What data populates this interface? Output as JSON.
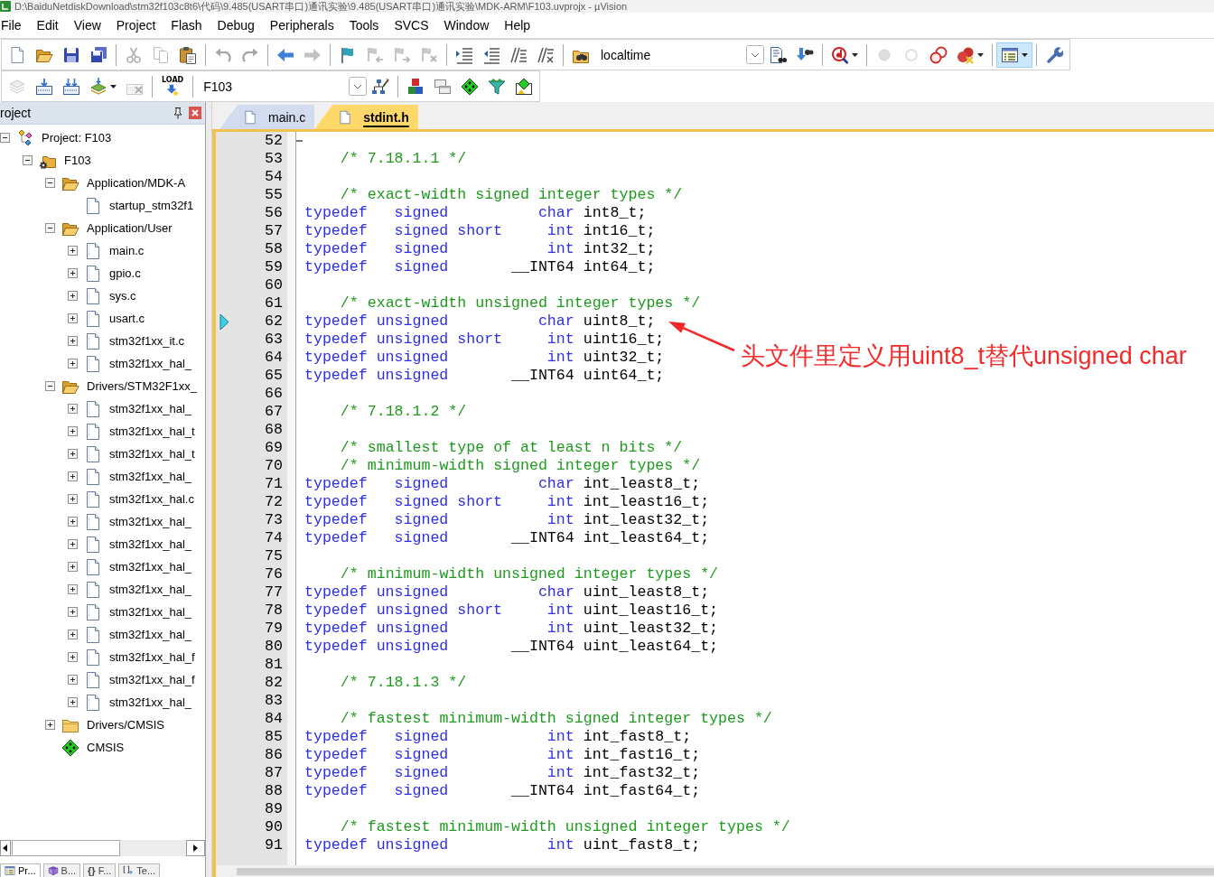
{
  "window": {
    "title": "D:\\BaiduNetdiskDownload\\stm32f103c8t6\\代码\\9.485(USART串口)通讯实验\\9.485(USART串口)通讯实验\\MDK-ARM\\F103.uvprojx - µVision"
  },
  "menu": [
    "File",
    "Edit",
    "View",
    "Project",
    "Flash",
    "Debug",
    "Peripherals",
    "Tools",
    "SVCS",
    "Window",
    "Help"
  ],
  "toolbar_1": {
    "items": [
      {
        "kind": "button",
        "disabled": false,
        "pressed": false,
        "menu": false
      },
      {
        "kind": "button",
        "disabled": false,
        "pressed": false,
        "menu": false
      },
      {
        "kind": "button",
        "disabled": false,
        "pressed": false,
        "menu": false
      },
      {
        "kind": "button",
        "disabled": false,
        "pressed": false,
        "menu": false
      },
      {
        "kind": "separator"
      },
      {
        "kind": "button",
        "disabled": true,
        "pressed": false,
        "menu": false
      },
      {
        "kind": "button",
        "disabled": true,
        "pressed": false,
        "menu": false
      },
      {
        "kind": "button",
        "disabled": false,
        "pressed": false,
        "menu": false
      },
      {
        "kind": "separator"
      },
      {
        "kind": "button",
        "disabled": true,
        "pressed": false,
        "menu": false
      },
      {
        "kind": "button",
        "disabled": true,
        "pressed": false,
        "menu": false
      },
      {
        "kind": "separator"
      },
      {
        "kind": "button",
        "disabled": false,
        "pressed": false,
        "menu": false
      },
      {
        "kind": "button",
        "disabled": true,
        "pressed": false,
        "menu": false
      },
      {
        "kind": "separator"
      },
      {
        "kind": "button",
        "disabled": false,
        "pressed": false,
        "menu": false
      },
      {
        "kind": "button",
        "disabled": true,
        "pressed": false,
        "menu": false
      },
      {
        "kind": "button",
        "disabled": true,
        "pressed": false,
        "menu": false
      },
      {
        "kind": "button",
        "disabled": true,
        "pressed": false,
        "menu": false
      },
      {
        "kind": "separator"
      },
      {
        "kind": "button",
        "disabled": false,
        "pressed": false,
        "menu": false
      },
      {
        "kind": "button",
        "disabled": false,
        "pressed": false,
        "menu": false
      },
      {
        "kind": "button",
        "disabled": false,
        "pressed": false,
        "menu": false
      },
      {
        "kind": "button",
        "disabled": false,
        "pressed": false,
        "menu": false
      },
      {
        "kind": "separator"
      },
      {
        "kind": "button",
        "disabled": false,
        "pressed": false,
        "menu": false
      },
      {
        "kind": "combo",
        "value": "localtime"
      },
      {
        "kind": "button",
        "disabled": false,
        "pressed": false,
        "menu": false
      },
      {
        "kind": "button",
        "disabled": false,
        "pressed": false,
        "menu": false
      },
      {
        "kind": "separator"
      },
      {
        "kind": "button",
        "disabled": false,
        "pressed": false,
        "menu": true
      },
      {
        "kind": "separator"
      },
      {
        "kind": "button",
        "disabled": true,
        "pressed": false,
        "menu": false
      },
      {
        "kind": "button",
        "disabled": true,
        "pressed": false,
        "menu": false
      },
      {
        "kind": "button",
        "disabled": false,
        "pressed": false,
        "menu": false
      },
      {
        "kind": "button",
        "disabled": false,
        "pressed": false,
        "menu": true
      },
      {
        "kind": "separator"
      },
      {
        "kind": "button",
        "disabled": false,
        "pressed": true,
        "menu": true
      },
      {
        "kind": "separator"
      },
      {
        "kind": "button",
        "disabled": false,
        "pressed": false,
        "menu": false
      }
    ]
  },
  "toolbar_2": {
    "items": [
      {
        "kind": "button",
        "disabled": true,
        "pressed": false,
        "menu": false
      },
      {
        "kind": "button",
        "disabled": false,
        "pressed": false,
        "menu": false
      },
      {
        "kind": "button",
        "disabled": false,
        "pressed": false,
        "menu": false
      },
      {
        "kind": "button",
        "disabled": false,
        "pressed": false,
        "menu": true
      },
      {
        "kind": "button",
        "disabled": true,
        "pressed": false,
        "menu": false
      },
      {
        "kind": "separator"
      },
      {
        "kind": "button",
        "label": "LOAD",
        "disabled": false,
        "pressed": false,
        "menu": false
      },
      {
        "kind": "separator"
      },
      {
        "kind": "combo",
        "value": "F103"
      },
      {
        "kind": "button",
        "disabled": false,
        "pressed": false,
        "menu": false
      },
      {
        "kind": "separator"
      },
      {
        "kind": "button",
        "disabled": false,
        "pressed": false,
        "menu": false
      },
      {
        "kind": "button",
        "disabled": false,
        "pressed": false,
        "menu": false
      },
      {
        "kind": "button",
        "disabled": false,
        "pressed": false,
        "menu": false
      },
      {
        "kind": "button",
        "disabled": false,
        "pressed": false,
        "menu": false
      },
      {
        "kind": "button",
        "disabled": false,
        "pressed": false,
        "menu": false
      }
    ]
  },
  "project_panel": {
    "title": "roject",
    "tree": [
      {
        "kind": "project",
        "label": "Project: F103",
        "expanded": true,
        "children": [
          {
            "kind": "target",
            "label": "F103",
            "expanded": true,
            "children": [
              {
                "kind": "folder",
                "label": "Application/MDK-A",
                "expanded": true,
                "children": [
                  {
                    "kind": "file",
                    "label": "startup_stm32f1"
                  }
                ]
              },
              {
                "kind": "folder",
                "label": "Application/User",
                "expanded": true,
                "children": [
                  {
                    "kind": "file",
                    "label": "main.c",
                    "expanded": false
                  },
                  {
                    "kind": "file",
                    "label": "gpio.c",
                    "expanded": false
                  },
                  {
                    "kind": "file",
                    "label": "sys.c",
                    "expanded": false
                  },
                  {
                    "kind": "file",
                    "label": "usart.c",
                    "expanded": false
                  },
                  {
                    "kind": "file",
                    "label": "stm32f1xx_it.c",
                    "expanded": false
                  },
                  {
                    "kind": "file",
                    "label": "stm32f1xx_hal_",
                    "expanded": false
                  }
                ]
              },
              {
                "kind": "folder",
                "label": "Drivers/STM32F1xx_",
                "expanded": true,
                "children": [
                  {
                    "kind": "file",
                    "label": "stm32f1xx_hal_",
                    "expanded": false
                  },
                  {
                    "kind": "file",
                    "label": "stm32f1xx_hal_t",
                    "expanded": false
                  },
                  {
                    "kind": "file",
                    "label": "stm32f1xx_hal_t",
                    "expanded": false
                  },
                  {
                    "kind": "file",
                    "label": "stm32f1xx_hal_",
                    "expanded": false
                  },
                  {
                    "kind": "file",
                    "label": "stm32f1xx_hal.c",
                    "expanded": false
                  },
                  {
                    "kind": "file",
                    "label": "stm32f1xx_hal_",
                    "expanded": false
                  },
                  {
                    "kind": "file",
                    "label": "stm32f1xx_hal_",
                    "expanded": false
                  },
                  {
                    "kind": "file",
                    "label": "stm32f1xx_hal_",
                    "expanded": false
                  },
                  {
                    "kind": "file",
                    "label": "stm32f1xx_hal_",
                    "expanded": false
                  },
                  {
                    "kind": "file",
                    "label": "stm32f1xx_hal_",
                    "expanded": false
                  },
                  {
                    "kind": "file",
                    "label": "stm32f1xx_hal_",
                    "expanded": false
                  },
                  {
                    "kind": "file",
                    "label": "stm32f1xx_hal_f",
                    "expanded": false
                  },
                  {
                    "kind": "file",
                    "label": "stm32f1xx_hal_f",
                    "expanded": false
                  },
                  {
                    "kind": "file",
                    "label": "stm32f1xx_hal_",
                    "expanded": false
                  }
                ]
              },
              {
                "kind": "folder",
                "label": "Drivers/CMSIS",
                "expanded": false
              },
              {
                "kind": "component",
                "label": "CMSIS"
              }
            ]
          }
        ]
      }
    ],
    "tabs": [
      {
        "label": "Pr...",
        "selected": true
      },
      {
        "label": "B...",
        "selected": false
      },
      {
        "glyph": "{}",
        "label": "F...",
        "selected": false
      },
      {
        "label": "Te...",
        "selected": false
      }
    ]
  },
  "editor": {
    "tabs": [
      {
        "label": "main.c",
        "selected": false
      },
      {
        "label": "stdint.h",
        "selected": true
      }
    ],
    "lines": [
      {
        "number": "52",
        "current": false,
        "fold_end": true
      },
      {
        "number": "53",
        "current": false,
        "fold_end": false,
        "tokens": [
          {
            "kind": "comment",
            "text": "    /* 7.18.1.1 */"
          }
        ]
      },
      {
        "number": "54",
        "current": false,
        "fold_end": false
      },
      {
        "number": "55",
        "current": false,
        "fold_end": false,
        "tokens": [
          {
            "kind": "comment",
            "text": "    /* exact-width signed integer types */"
          }
        ]
      },
      {
        "number": "56",
        "current": false,
        "fold_end": false,
        "tokens": [
          {
            "kind": "keyword",
            "text": "typedef   signed          char"
          },
          {
            "kind": "plain",
            "text": " int8_t;"
          }
        ]
      },
      {
        "number": "57",
        "current": false,
        "fold_end": false,
        "tokens": [
          {
            "kind": "keyword",
            "text": "typedef   signed short     int"
          },
          {
            "kind": "plain",
            "text": " int16_t;"
          }
        ]
      },
      {
        "number": "58",
        "current": false,
        "fold_end": false,
        "tokens": [
          {
            "kind": "keyword",
            "text": "typedef   signed           int"
          },
          {
            "kind": "plain",
            "text": " int32_t;"
          }
        ]
      },
      {
        "number": "59",
        "current": false,
        "fold_end": false,
        "tokens": [
          {
            "kind": "keyword",
            "text": "typedef   signed       "
          },
          {
            "kind": "plain",
            "text": "__INT64 int64_t;"
          }
        ]
      },
      {
        "number": "60",
        "current": false,
        "fold_end": false
      },
      {
        "number": "61",
        "current": false,
        "fold_end": false,
        "tokens": [
          {
            "kind": "comment",
            "text": "    /* exact-width unsigned integer types */"
          }
        ]
      },
      {
        "number": "62",
        "current": true,
        "fold_end": false,
        "tokens": [
          {
            "kind": "keyword",
            "text": "typedef unsigned          char"
          },
          {
            "kind": "plain",
            "text": " uint8_t;"
          }
        ]
      },
      {
        "number": "63",
        "current": false,
        "fold_end": false,
        "tokens": [
          {
            "kind": "keyword",
            "text": "typedef unsigned short     int"
          },
          {
            "kind": "plain",
            "text": " uint16_t;"
          }
        ]
      },
      {
        "number": "64",
        "current": false,
        "fold_end": false,
        "tokens": [
          {
            "kind": "keyword",
            "text": "typedef unsigned           int"
          },
          {
            "kind": "plain",
            "text": " uint32_t;"
          }
        ]
      },
      {
        "number": "65",
        "current": false,
        "fold_end": false,
        "tokens": [
          {
            "kind": "keyword",
            "text": "typedef unsigned       "
          },
          {
            "kind": "plain",
            "text": "__INT64 uint64_t;"
          }
        ]
      },
      {
        "number": "66",
        "current": false,
        "fold_end": false
      },
      {
        "number": "67",
        "current": false,
        "fold_end": false,
        "tokens": [
          {
            "kind": "comment",
            "text": "    /* 7.18.1.2 */"
          }
        ]
      },
      {
        "number": "68",
        "current": false,
        "fold_end": false
      },
      {
        "number": "69",
        "current": false,
        "fold_end": false,
        "tokens": [
          {
            "kind": "comment",
            "text": "    /* smallest type of at least n bits */"
          }
        ]
      },
      {
        "number": "70",
        "current": false,
        "fold_end": false,
        "tokens": [
          {
            "kind": "comment",
            "text": "    /* minimum-width signed integer types */"
          }
        ]
      },
      {
        "number": "71",
        "current": false,
        "fold_end": false,
        "tokens": [
          {
            "kind": "keyword",
            "text": "typedef   signed          char"
          },
          {
            "kind": "plain",
            "text": " int_least8_t;"
          }
        ]
      },
      {
        "number": "72",
        "current": false,
        "fold_end": false,
        "tokens": [
          {
            "kind": "keyword",
            "text": "typedef   signed short     int"
          },
          {
            "kind": "plain",
            "text": " int_least16_t;"
          }
        ]
      },
      {
        "number": "73",
        "current": false,
        "fold_end": false,
        "tokens": [
          {
            "kind": "keyword",
            "text": "typedef   signed           int"
          },
          {
            "kind": "plain",
            "text": " int_least32_t;"
          }
        ]
      },
      {
        "number": "74",
        "current": false,
        "fold_end": false,
        "tokens": [
          {
            "kind": "keyword",
            "text": "typedef   signed       "
          },
          {
            "kind": "plain",
            "text": "__INT64 int_least64_t;"
          }
        ]
      },
      {
        "number": "75",
        "current": false,
        "fold_end": false
      },
      {
        "number": "76",
        "current": false,
        "fold_end": false,
        "tokens": [
          {
            "kind": "comment",
            "text": "    /* minimum-width unsigned integer types */"
          }
        ]
      },
      {
        "number": "77",
        "current": false,
        "fold_end": false,
        "tokens": [
          {
            "kind": "keyword",
            "text": "typedef unsigned          char"
          },
          {
            "kind": "plain",
            "text": " uint_least8_t;"
          }
        ]
      },
      {
        "number": "78",
        "current": false,
        "fold_end": false,
        "tokens": [
          {
            "kind": "keyword",
            "text": "typedef unsigned short     int"
          },
          {
            "kind": "plain",
            "text": " uint_least16_t;"
          }
        ]
      },
      {
        "number": "79",
        "current": false,
        "fold_end": false,
        "tokens": [
          {
            "kind": "keyword",
            "text": "typedef unsigned           int"
          },
          {
            "kind": "plain",
            "text": " uint_least32_t;"
          }
        ]
      },
      {
        "number": "80",
        "current": false,
        "fold_end": false,
        "tokens": [
          {
            "kind": "keyword",
            "text": "typedef unsigned       "
          },
          {
            "kind": "plain",
            "text": "__INT64 uint_least64_t;"
          }
        ]
      },
      {
        "number": "81",
        "current": false,
        "fold_end": false
      },
      {
        "number": "82",
        "current": false,
        "fold_end": false,
        "tokens": [
          {
            "kind": "comment",
            "text": "    /* 7.18.1.3 */"
          }
        ]
      },
      {
        "number": "83",
        "current": false,
        "fold_end": false
      },
      {
        "number": "84",
        "current": false,
        "fold_end": false,
        "tokens": [
          {
            "kind": "comment",
            "text": "    /* fastest minimum-width signed integer types */"
          }
        ]
      },
      {
        "number": "85",
        "current": false,
        "fold_end": false,
        "tokens": [
          {
            "kind": "keyword",
            "text": "typedef   signed           int"
          },
          {
            "kind": "plain",
            "text": " int_fast8_t;"
          }
        ]
      },
      {
        "number": "86",
        "current": false,
        "fold_end": false,
        "tokens": [
          {
            "kind": "keyword",
            "text": "typedef   signed           int"
          },
          {
            "kind": "plain",
            "text": " int_fast16_t;"
          }
        ]
      },
      {
        "number": "87",
        "current": false,
        "fold_end": false,
        "tokens": [
          {
            "kind": "keyword",
            "text": "typedef   signed           int"
          },
          {
            "kind": "plain",
            "text": " int_fast32_t;"
          }
        ]
      },
      {
        "number": "88",
        "current": false,
        "fold_end": false,
        "tokens": [
          {
            "kind": "keyword",
            "text": "typedef   signed       "
          },
          {
            "kind": "plain",
            "text": "__INT64 int_fast64_t;"
          }
        ]
      },
      {
        "number": "89",
        "current": false,
        "fold_end": false
      },
      {
        "number": "90",
        "current": false,
        "fold_end": false,
        "tokens": [
          {
            "kind": "comment",
            "text": "    /* fastest minimum-width unsigned integer types */"
          }
        ]
      },
      {
        "number": "91",
        "current": false,
        "fold_end": false,
        "tokens": [
          {
            "kind": "keyword",
            "text": "typedef unsigned           int"
          },
          {
            "kind": "plain",
            "text": " uint_fast8_t;"
          }
        ]
      }
    ]
  },
  "annotation": {
    "text": "头文件里定义用uint8_t替代unsigned char"
  }
}
